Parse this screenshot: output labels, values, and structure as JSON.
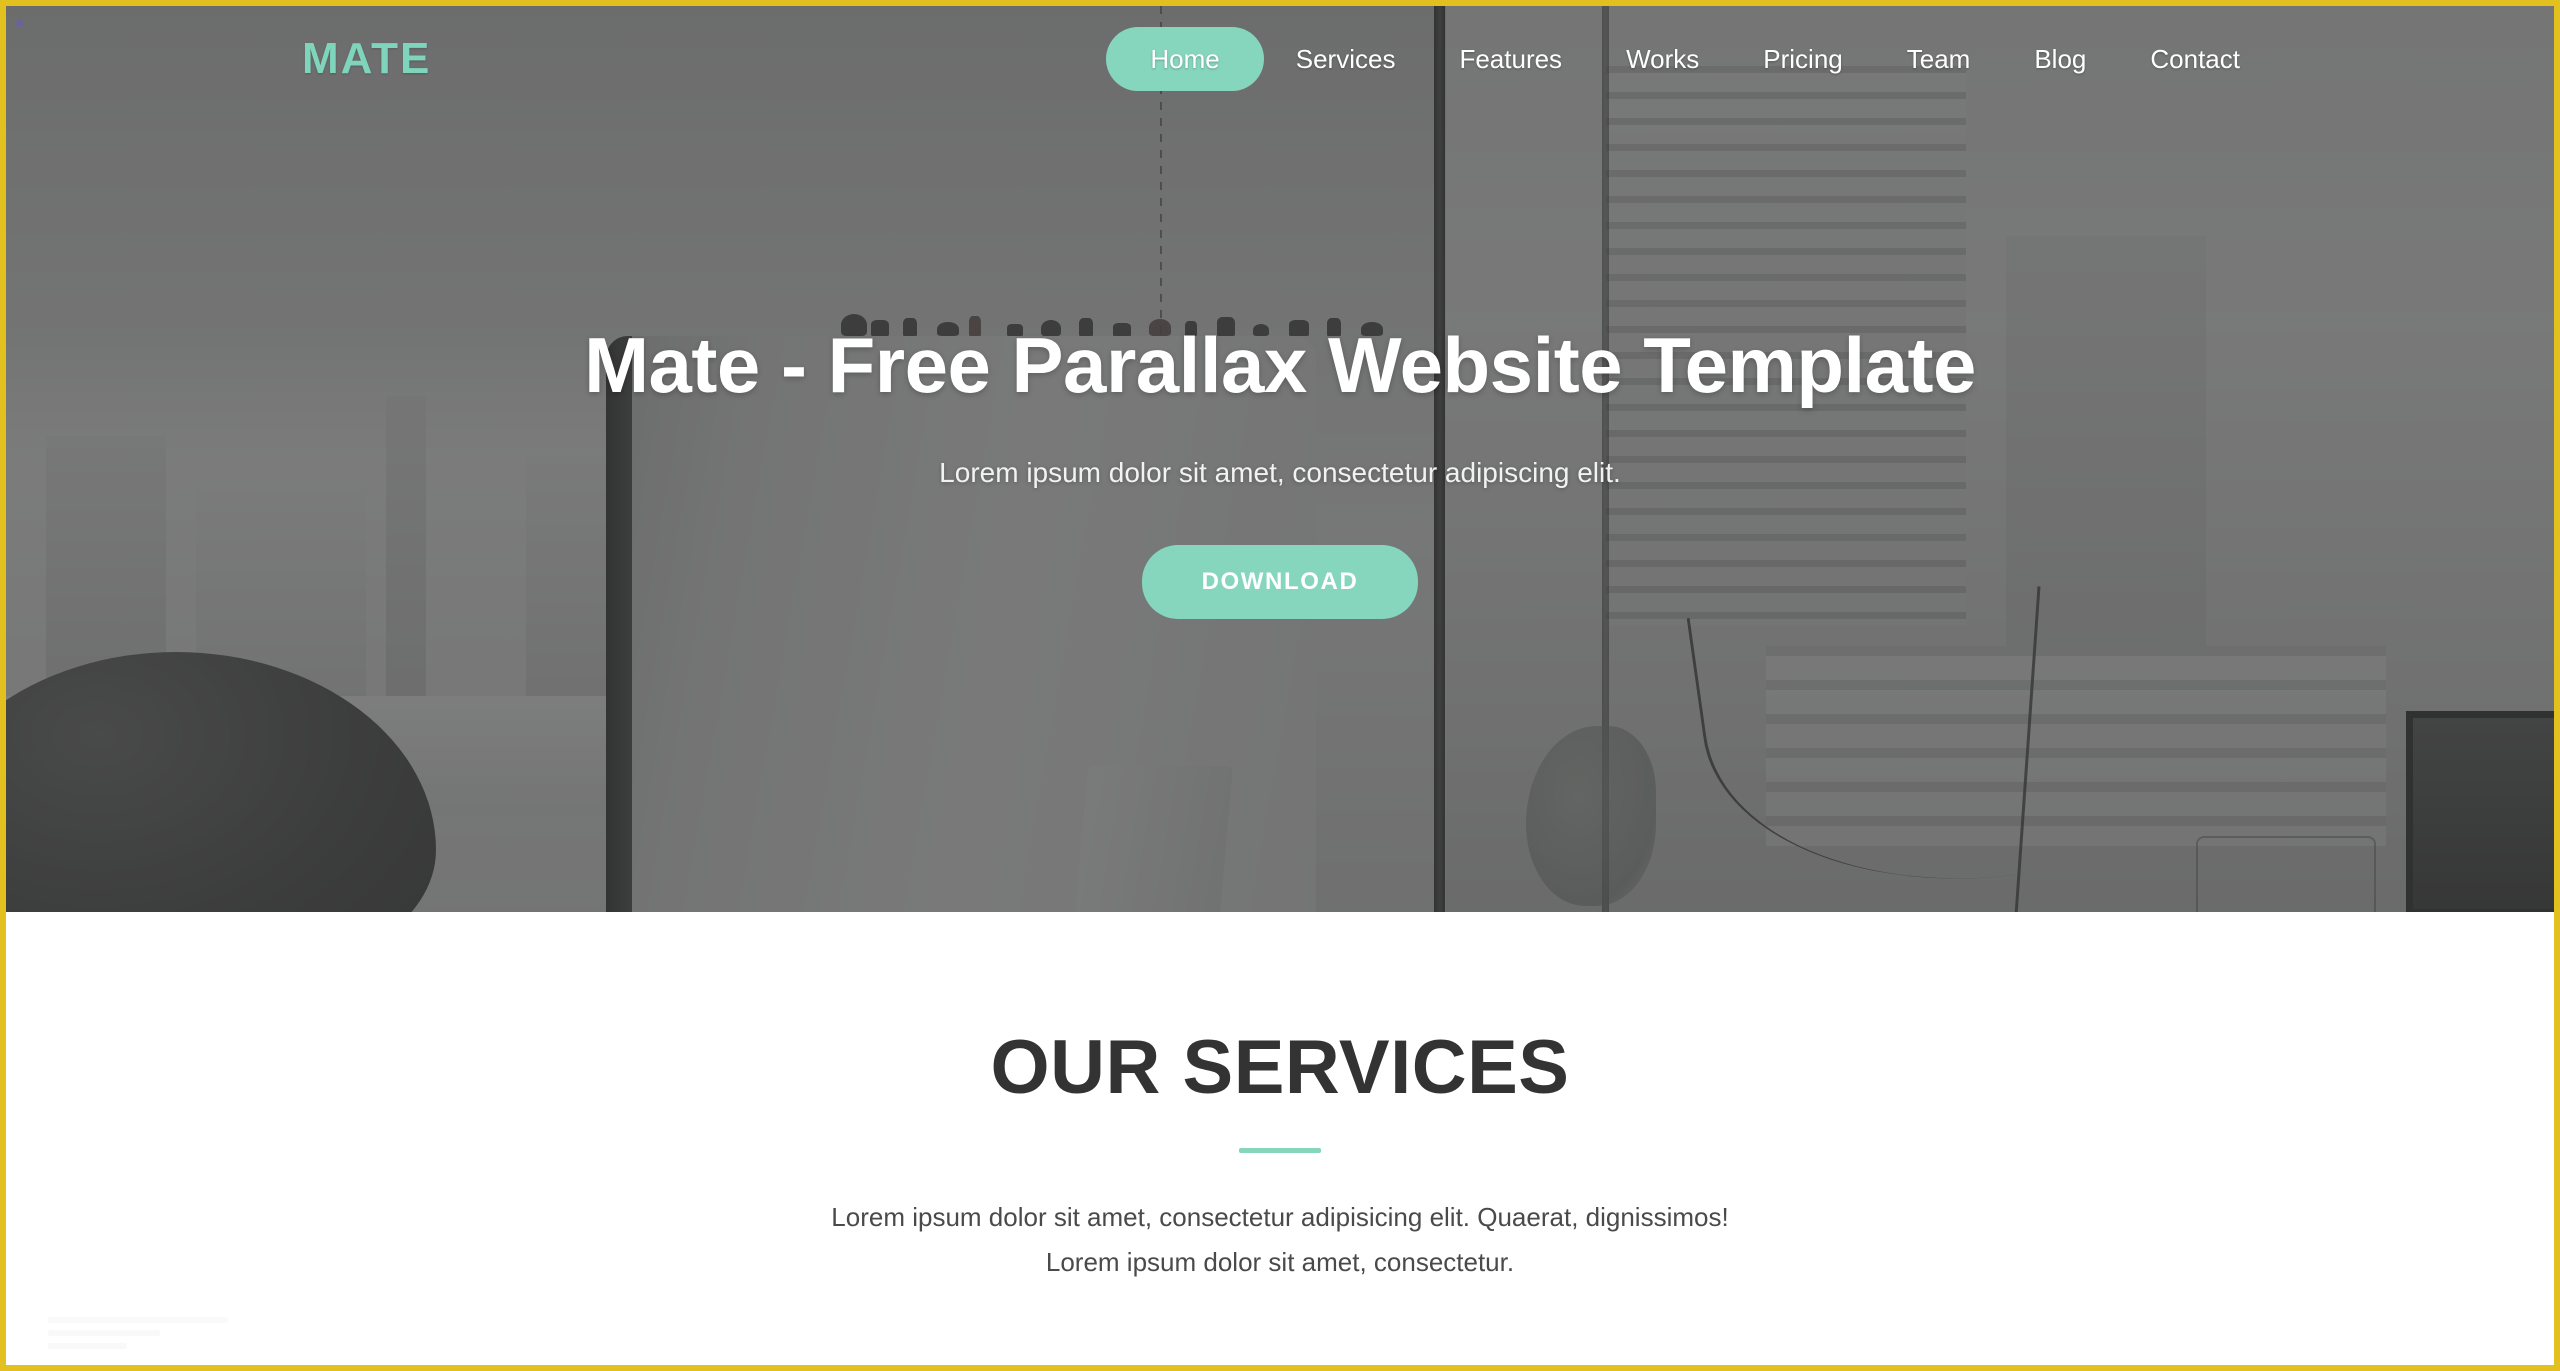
{
  "theme": {
    "accent": "#86d5bd",
    "logo_color": "#7fd4bc",
    "heading_color": "#333333",
    "hero_overlay": "#3c3c3c",
    "viewport_border": "#e2c01f",
    "page_background": "#ffffff"
  },
  "navbar": {
    "logo": "MATE",
    "items": [
      {
        "label": "Home",
        "active": true
      },
      {
        "label": "Services",
        "active": false
      },
      {
        "label": "Features",
        "active": false
      },
      {
        "label": "Works",
        "active": false
      },
      {
        "label": "Pricing",
        "active": false
      },
      {
        "label": "Team",
        "active": false
      },
      {
        "label": "Blog",
        "active": false
      },
      {
        "label": "Contact",
        "active": false
      }
    ]
  },
  "hero": {
    "title": "Mate - Free Parallax Website Template",
    "subtitle": "Lorem ipsum dolor sit amet, consectetur adipiscing elit.",
    "cta_label": "DOWNLOAD"
  },
  "services": {
    "title": "OUR SERVICES",
    "paragraph_line_1": "Lorem ipsum dolor sit amet, consectetur adipisicing elit. Quaerat, dignissimos!",
    "paragraph_line_2": "Lorem ipsum dolor sit amet, consectetur."
  }
}
